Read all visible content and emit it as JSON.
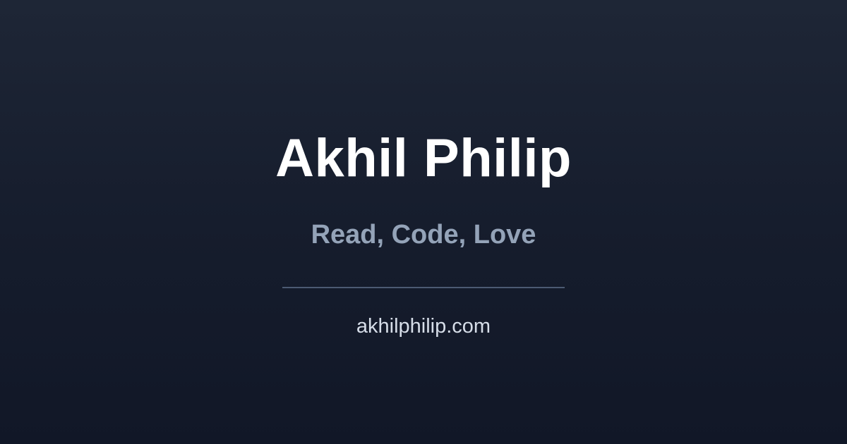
{
  "card": {
    "title": "Akhil Philip",
    "tagline": "Read, Code, Love",
    "domain": "akhilphilip.com"
  },
  "colors": {
    "background_top": "#1e2636",
    "background_bottom": "#111727",
    "title": "#ffffff",
    "tagline": "#94a3b8",
    "divider": "#4b5a72",
    "domain": "#d6dde8"
  }
}
